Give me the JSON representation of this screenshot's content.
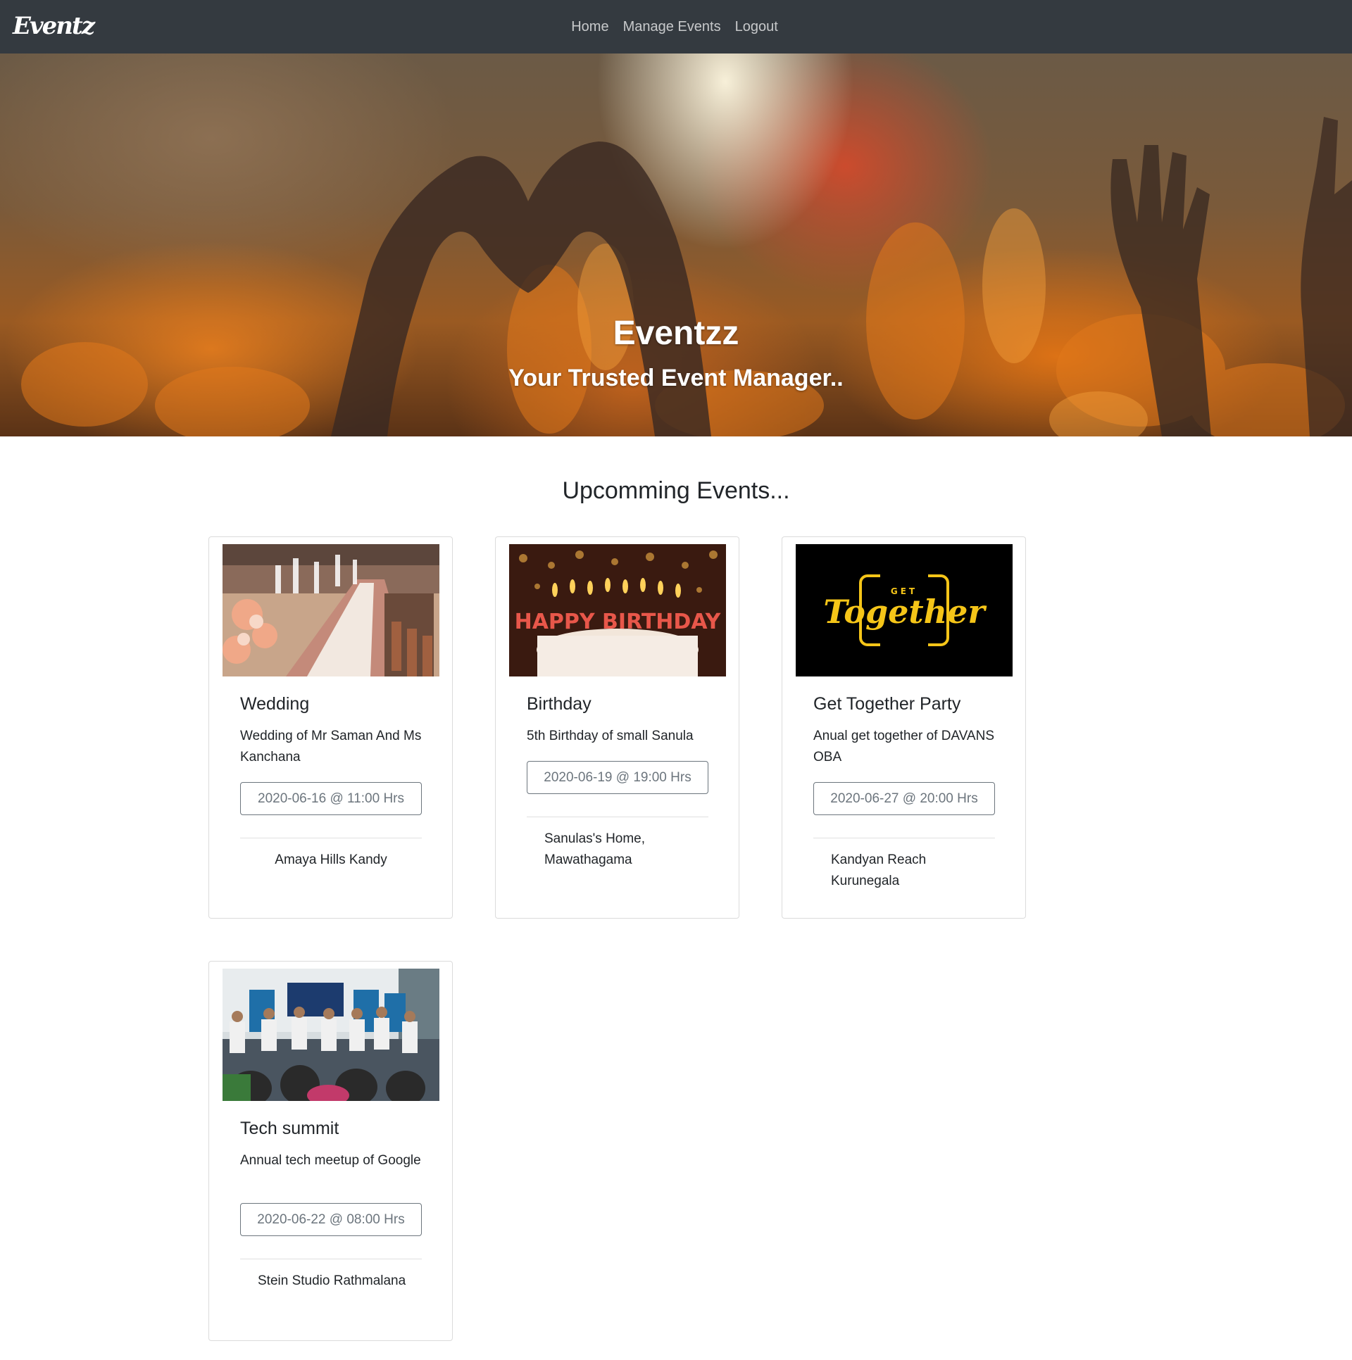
{
  "navbar": {
    "brand": "Eventz",
    "links": [
      "Home",
      "Manage Events",
      "Logout"
    ]
  },
  "hero": {
    "title": "Eventzz",
    "subtitle": "Your Trusted Event Manager.."
  },
  "section_title": "Upcomming Events...",
  "events": [
    {
      "title": "Wedding",
      "description": "Wedding of Mr Saman And Ms Kanchana",
      "datetime": "2020-06-16 @ 11:00 Hrs",
      "venue": "Amaya Hills Kandy"
    },
    {
      "title": "Birthday",
      "description": "5th Birthday of small Sanula",
      "datetime": "2020-06-19 @ 19:00 Hrs",
      "venue": "Sanulas's Home, Mawathagama",
      "image_text": "HAPPY BIRTHDAY"
    },
    {
      "title": "Get Together Party",
      "description": "Anual get together of DAVANS OBA",
      "datetime": "2020-06-27 @ 20:00 Hrs",
      "venue": "Kandyan Reach Kurunegala",
      "image_text_top": "GET",
      "image_text_main": "Together"
    },
    {
      "title": "Tech summit",
      "description": "Annual tech meetup of Google",
      "datetime": "2020-06-22 @ 08:00 Hrs",
      "venue": "Stein Studio Rathmalana"
    }
  ],
  "colors": {
    "navbar_bg": "#343a40",
    "nav_link": "#c9cacb",
    "outline_secondary": "#6c757d",
    "together_gold": "#f5c518"
  }
}
